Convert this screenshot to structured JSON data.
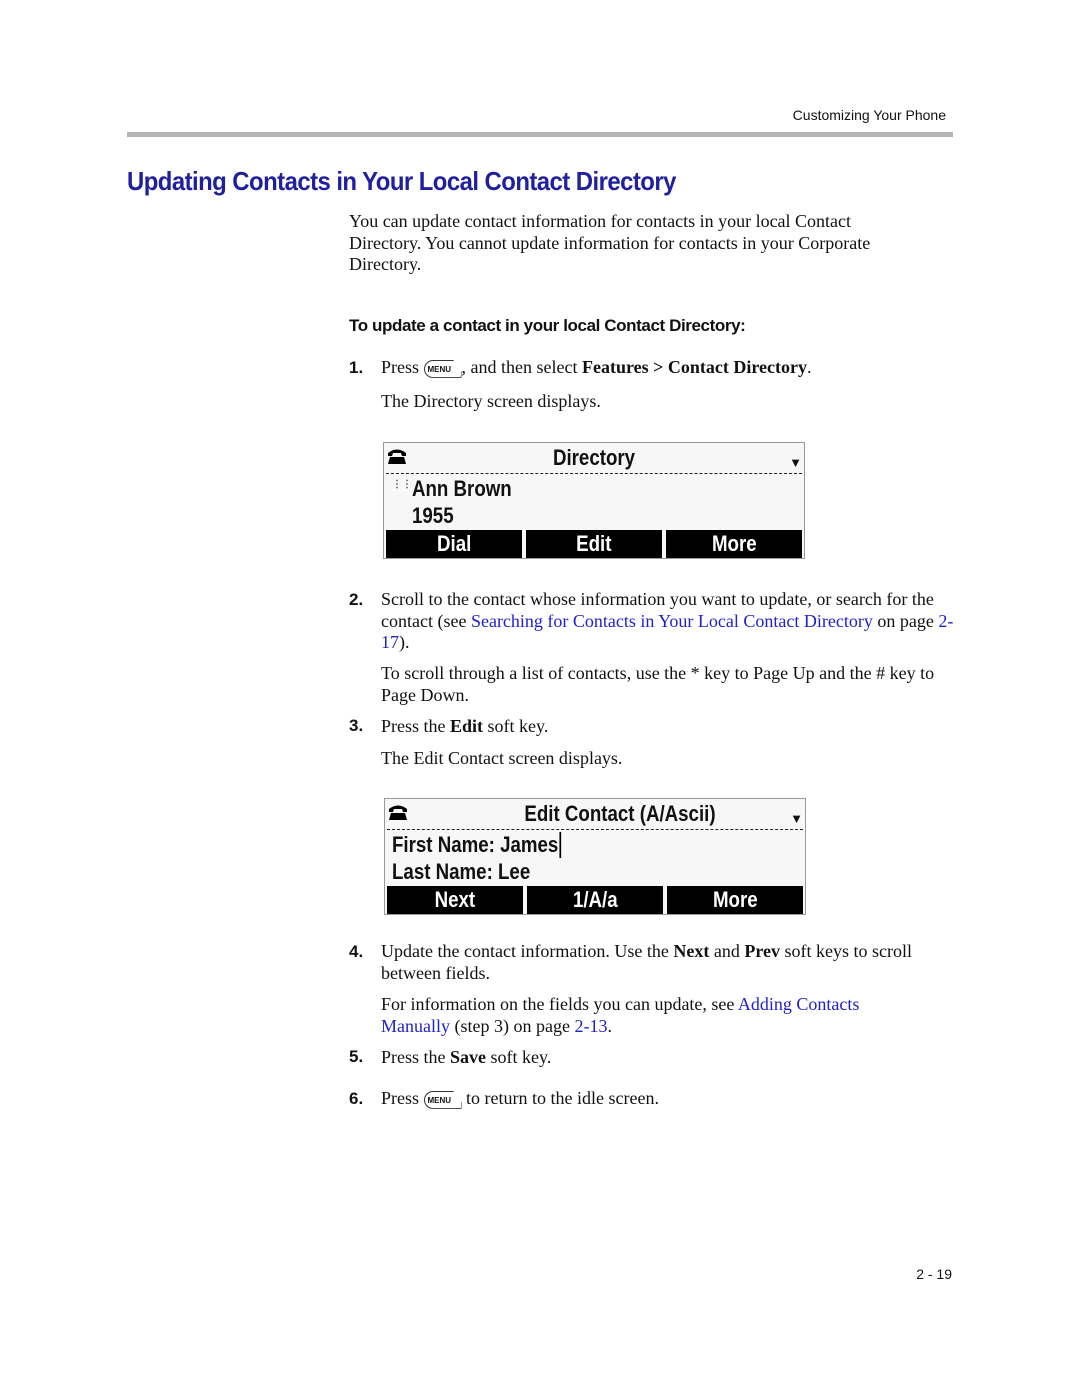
{
  "header": {
    "section": "Customizing Your Phone",
    "page_number": "2 - 19"
  },
  "title": "Updating Contacts in Your Local Contact Directory",
  "intro": "You can update contact information for contacts in your local Contact Directory. You cannot update information for contacts in your Corporate Directory.",
  "procedure_title": "To update a contact in your local Contact Directory:",
  "steps": {
    "s1": {
      "num": "1.",
      "a": "Press",
      "b": ", and then select",
      "c": "Features",
      "d": " > ",
      "e": "Contact Directory",
      "f": ".",
      "note": "The Directory screen displays."
    },
    "s2": {
      "num": "2.",
      "a": "Scroll to the contact whose information you want to update, or search for the contact (see ",
      "link": "Searching for Contacts in Your Local Contact Directory",
      "b": " on page ",
      "page": "2-17",
      "c": ").",
      "note": "To scroll through a list of contacts, use the * key to Page Up and the # key to Page Down."
    },
    "s3": {
      "num": "3.",
      "a": "Press the ",
      "b": "Edit",
      "c": " soft key.",
      "note": "The Edit Contact screen displays."
    },
    "s4": {
      "num": "4.",
      "a": "Update the contact information. Use the ",
      "b": "Next",
      "c": " and ",
      "d": "Prev",
      "e": " soft keys to scroll between fields.",
      "note_a": "For information on the fields you can update, see ",
      "link": "Adding Contacts Manually",
      "note_b": " (step 3) on page ",
      "page": "2-13",
      "note_c": "."
    },
    "s5": {
      "num": "5.",
      "a": "Press the ",
      "b": "Save",
      "c": " soft key."
    },
    "s6": {
      "num": "6.",
      "a": "Press",
      "b": " to return to the idle screen."
    }
  },
  "menu_key_label": "MENU",
  "screen1": {
    "title": "Directory",
    "name": "Ann Brown",
    "number": "1955",
    "keys": [
      "Dial",
      "Edit",
      "More"
    ]
  },
  "screen2": {
    "title": "Edit Contact (A/Ascii)",
    "first": "First Name: James",
    "last": "Last Name: Lee",
    "keys": [
      "Next",
      "1/A/a",
      "More"
    ]
  },
  "colors": {
    "heading": "#1f1fa0",
    "link": "#1f1fcc"
  }
}
